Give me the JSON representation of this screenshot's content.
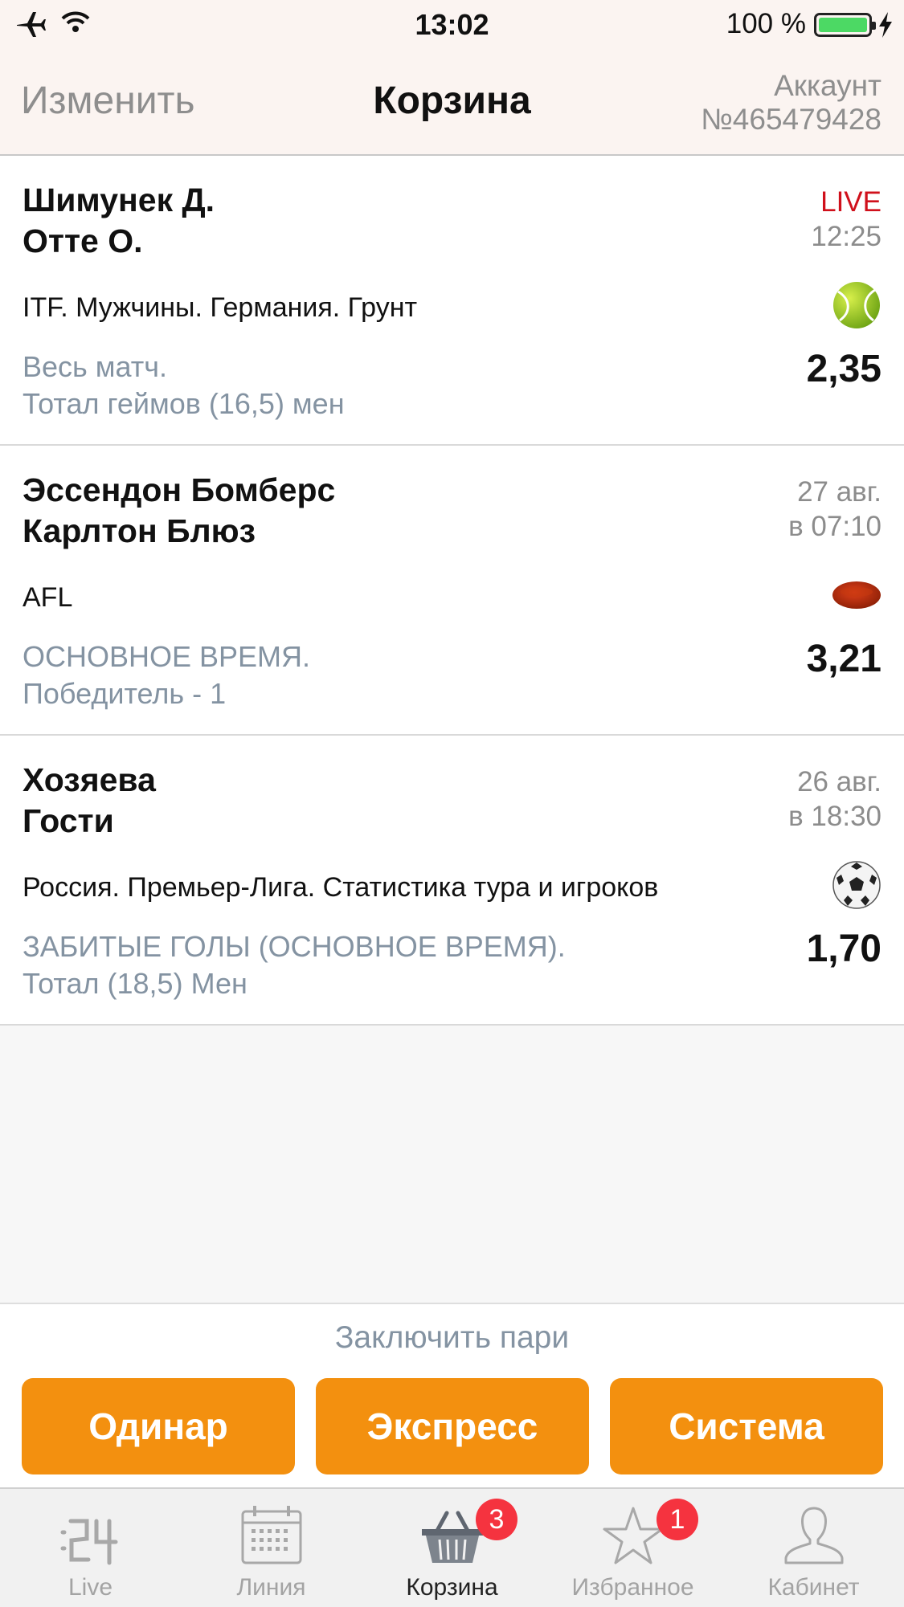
{
  "status_bar": {
    "time": "13:02",
    "battery_text": "100 %",
    "battery_level": 1.0,
    "icons": [
      "airplane-icon",
      "wifi-icon",
      "battery-icon",
      "charging-bolt-icon"
    ]
  },
  "nav": {
    "edit_label": "Изменить",
    "title": "Корзина",
    "account_label": "Аккаунт",
    "account_number": "№465479428"
  },
  "bets": [
    {
      "team1": "Шимунек Д.",
      "team2": "Отте О.",
      "when_line1": "LIVE",
      "when_line2": "12:25",
      "tournament": "ITF. Мужчины. Германия. Грунт",
      "sport_icon": "tennis-ball-icon",
      "market_line1": "Весь матч.",
      "market_line2": "Тотал геймов (16,5) мен",
      "odds": "2,35"
    },
    {
      "team1": "Эссендон Бомберс",
      "team2": "Карлтон Блюз",
      "when_line1": "27 авг.",
      "when_line2": "в 07:10",
      "tournament": "AFL",
      "sport_icon": "football-oval-icon",
      "market_line1": "ОСНОВНОЕ ВРЕМЯ.",
      "market_line2": "Победитель - 1",
      "odds": "3,21"
    },
    {
      "team1": "Хозяева",
      "team2": "Гости",
      "when_line1": "26 авг.",
      "when_line2": "в 18:30",
      "tournament": "Россия. Премьер-Лига. Статистика тура и игроков",
      "sport_icon": "soccer-ball-icon",
      "market_line1": "ЗАБИТЫЕ ГОЛЫ (ОСНОВНОЕ ВРЕМЯ).",
      "market_line2": "Тотал (18,5) Мен",
      "odds": "1,70"
    }
  ],
  "place_bets": {
    "label": "Заключить пари",
    "single": "Одинар",
    "express": "Экспресс",
    "system": "Система"
  },
  "tabs": [
    {
      "label": "Live",
      "icon": "live-clock-icon"
    },
    {
      "label": "Линия",
      "icon": "calendar-icon"
    },
    {
      "label": "Корзина",
      "icon": "basket-icon",
      "badge": "3",
      "active": true
    },
    {
      "label": "Избранное",
      "icon": "star-icon",
      "badge": "1"
    },
    {
      "label": "Кабинет",
      "icon": "profile-icon"
    }
  ],
  "colors": {
    "accent": "#f3900f",
    "live": "#d0101b",
    "badge": "#f5333f",
    "muted_text": "#8493a2"
  }
}
